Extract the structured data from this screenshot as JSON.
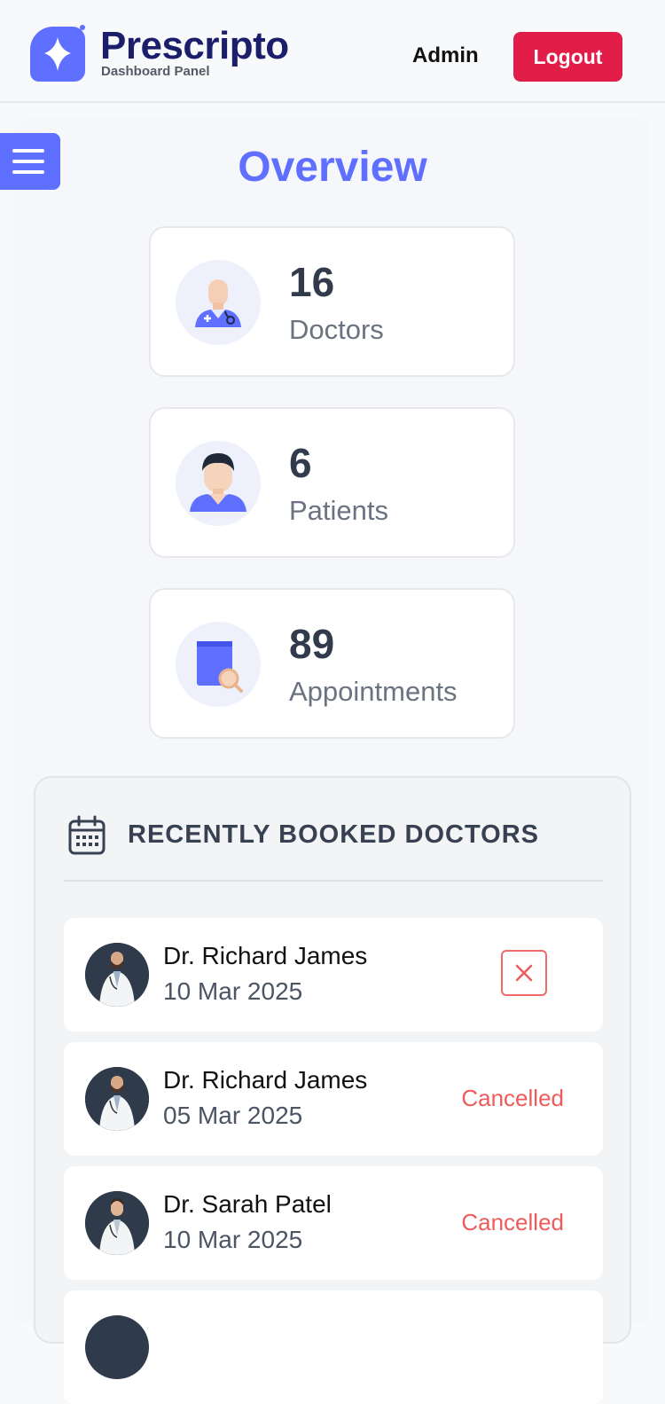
{
  "header": {
    "brand_name": "Prescripto",
    "brand_subtitle": "Dashboard Panel",
    "role_label": "Admin",
    "logout_label": "Logout"
  },
  "overview": {
    "title": "Overview",
    "stats": [
      {
        "value": "16",
        "label": "Doctors",
        "icon": "doctor-icon"
      },
      {
        "value": "6",
        "label": "Patients",
        "icon": "patient-icon"
      },
      {
        "value": "89",
        "label": "Appointments",
        "icon": "appointment-book-icon"
      }
    ]
  },
  "recent": {
    "title": "RECENTLY BOOKED DOCTORS",
    "bookings": [
      {
        "name": "Dr. Richard James",
        "date": "10 Mar 2025",
        "status": ""
      },
      {
        "name": "Dr. Richard James",
        "date": "05 Mar 2025",
        "status": "Cancelled"
      },
      {
        "name": "Dr. Sarah Patel",
        "date": "10 Mar 2025",
        "status": "Cancelled"
      }
    ]
  },
  "colors": {
    "accent": "#5f6fff",
    "brand": "#1b1f6b",
    "logout": "#e11d48",
    "cancelled": "#ef5b5b"
  }
}
